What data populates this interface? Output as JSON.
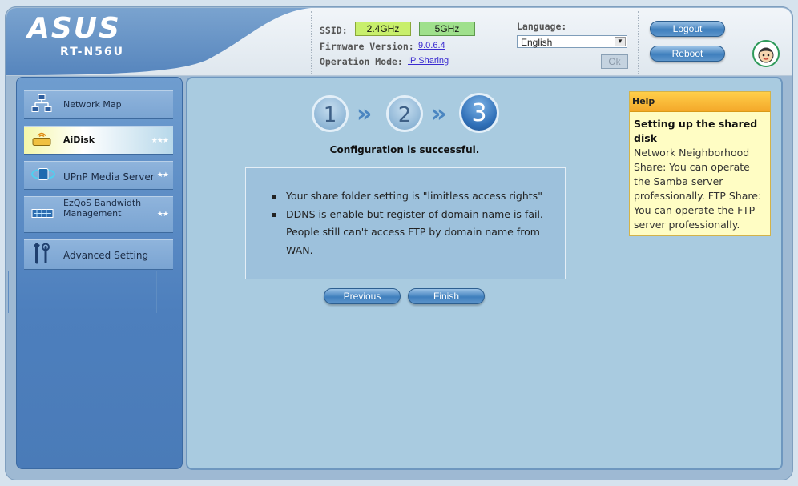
{
  "brand": {
    "logo": "ASUS",
    "model": "RT-N56U"
  },
  "header": {
    "ssid_label": "SSID:",
    "ssid_24": "2.4GHz",
    "ssid_5": "5GHz",
    "firmware_label": "Firmware Version:",
    "firmware_value": "9.0.6.4",
    "opmode_label": "Operation Mode:",
    "opmode_value": "IP Sharing",
    "language_label": "Language:",
    "language_selected": "English",
    "ok_label": "Ok",
    "logout_label": "Logout",
    "reboot_label": "Reboot"
  },
  "sidebar": {
    "items": [
      {
        "label": "Network Map",
        "icon": "network-map-icon"
      },
      {
        "label": "AiDisk",
        "icon": "aidisk-icon",
        "stars": "★★★"
      },
      {
        "label": "UPnP Media Server",
        "icon": "upnp-icon",
        "stars": "★★"
      },
      {
        "label": "EzQoS Bandwidth Management",
        "icon": "qos-icon",
        "stars": "★★"
      },
      {
        "label": "Advanced Setting",
        "icon": "tools-icon"
      }
    ]
  },
  "wizard": {
    "steps": [
      "1",
      "2",
      "3"
    ],
    "active_step": 3,
    "status": "Configuration is successful.",
    "messages": [
      "Your share folder setting is \"limitless access rights\"",
      "DDNS is enable but register of domain name is fail. People still can't access FTP by domain name from WAN."
    ],
    "previous_label": "Previous",
    "finish_label": "Finish"
  },
  "help": {
    "header": "Help",
    "title": "Setting up the shared disk",
    "body": "Network Neighborhood Share: You can operate the Samba server professionally. FTP Share: You can operate the FTP server professionally."
  },
  "colors": {
    "accent_blue": "#3f7fbd",
    "ssid_24": "#c8ef6c",
    "ssid_5": "#9fe08c",
    "help_header": "#f4a82a",
    "help_bg": "#fffdc4"
  }
}
